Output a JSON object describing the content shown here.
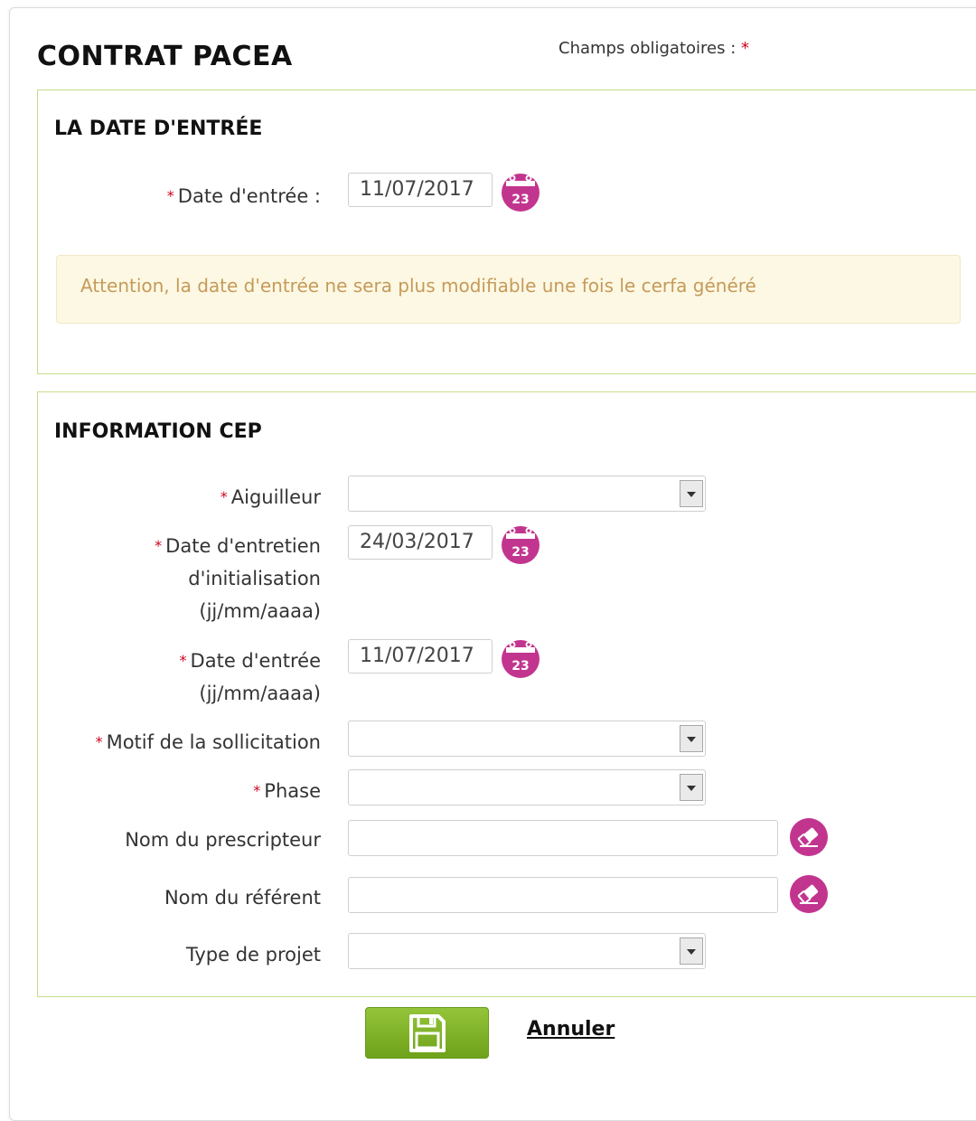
{
  "page_title": "CONTRAT PACEA",
  "required_note": "Champs obligatoires :",
  "required_mark": "*",
  "section_entry": {
    "title": "LA DATE D'ENTRÉE",
    "date_label": "Date d'entrée :",
    "date_value": "11/07/2017",
    "calendar_day": "23",
    "alert_text": "Attention, la date d'entrée ne sera plus modifiable une fois le cerfa généré"
  },
  "section_cep": {
    "title": "INFORMATION CEP",
    "aiguilleur_label": "Aiguilleur",
    "aiguilleur_value": "",
    "entretien_label_1": "Date d'entretien",
    "entretien_label_2": "d'initialisation",
    "entretien_label_3": "(jj/mm/aaaa)",
    "entretien_value": "24/03/2017",
    "entree_label_1": "Date d'entrée",
    "entree_label_2": "(jj/mm/aaaa)",
    "entree_value": "11/07/2017",
    "motif_label": "Motif de la sollicitation",
    "motif_value": "",
    "phase_label": "Phase",
    "phase_value": "",
    "prescripteur_label": "Nom du prescripteur",
    "prescripteur_value": "",
    "referent_label": "Nom du référent",
    "referent_value": "",
    "projet_label": "Type de projet",
    "projet_value": ""
  },
  "actions": {
    "save_icon": "floppy-disk-icon",
    "cancel_label": "Annuler"
  },
  "colors": {
    "section_border": "#c5dc8a",
    "icon_magenta": "#c2358f",
    "required_red": "#d0021b",
    "alert_bg": "#fcf8e3",
    "alert_text": "#c69a5a",
    "save_green": "#7cb125"
  }
}
